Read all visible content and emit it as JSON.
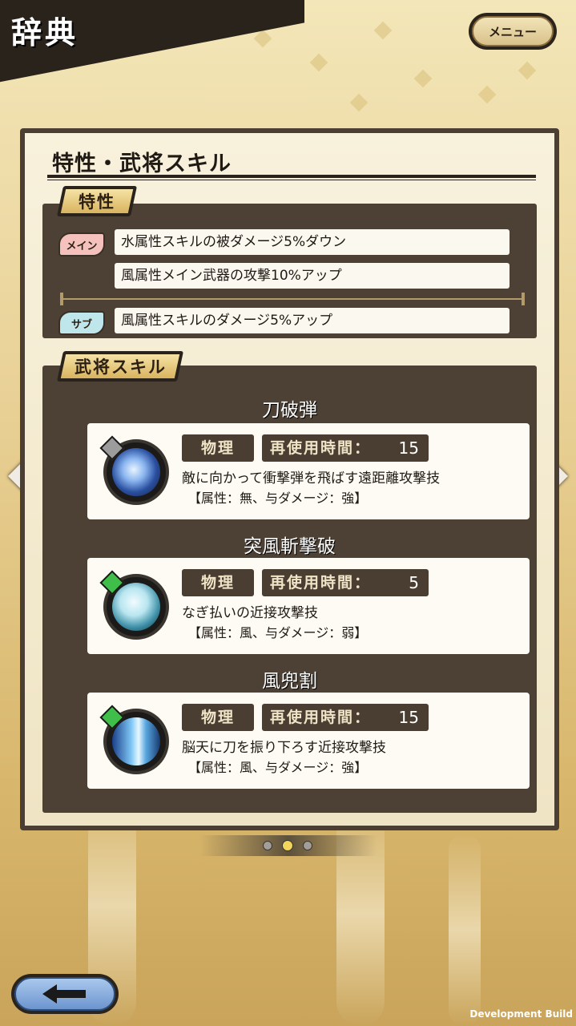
{
  "header": {
    "title": "辞典",
    "menu_label": "メニュー"
  },
  "panel": {
    "title": "特性・武将スキル",
    "traits": {
      "tag": "特性",
      "main_badge": "メイン",
      "sub_badge": "サブ",
      "main": [
        "水属性スキルの被ダメージ5%ダウン",
        "風属性メイン武器の攻撃10%アップ"
      ],
      "sub": [
        "風属性スキルのダメージ5%アップ"
      ]
    },
    "skills": {
      "tag": "武将スキル",
      "items": [
        {
          "name": "刀破弾",
          "type": "物理",
          "cooldown_label": "再使用時間：",
          "cooldown": "15",
          "description": "敵に向かって衝撃弾を飛ばす遠距離攻撃技",
          "attributes": "【属性：無、与ダメージ：強】",
          "icon": "shockwave-skill-icon"
        },
        {
          "name": "突風斬撃破",
          "type": "物理",
          "cooldown_label": "再使用時間：",
          "cooldown": "5",
          "description": "なぎ払いの近接攻撃技",
          "attributes": "【属性：風、与ダメージ：弱】",
          "icon": "wind-slash-skill-icon"
        },
        {
          "name": "風兜割",
          "type": "物理",
          "cooldown_label": "再使用時間：",
          "cooldown": "15",
          "description": "脳天に刀を振り下ろす近接攻撃技",
          "attributes": "【属性：風、与ダメージ：強】",
          "icon": "downward-slash-skill-icon"
        }
      ]
    }
  },
  "pager": {
    "pages": 3,
    "current": 2
  },
  "footer": {
    "dev_label": "Development Build"
  },
  "colors": {
    "panel_dark": "#4d4135",
    "gold_tag": "#d9b45e",
    "back_button": "#6c95cf",
    "wind_gem": "#3fbf4a",
    "neutral_gem": "#888888"
  }
}
